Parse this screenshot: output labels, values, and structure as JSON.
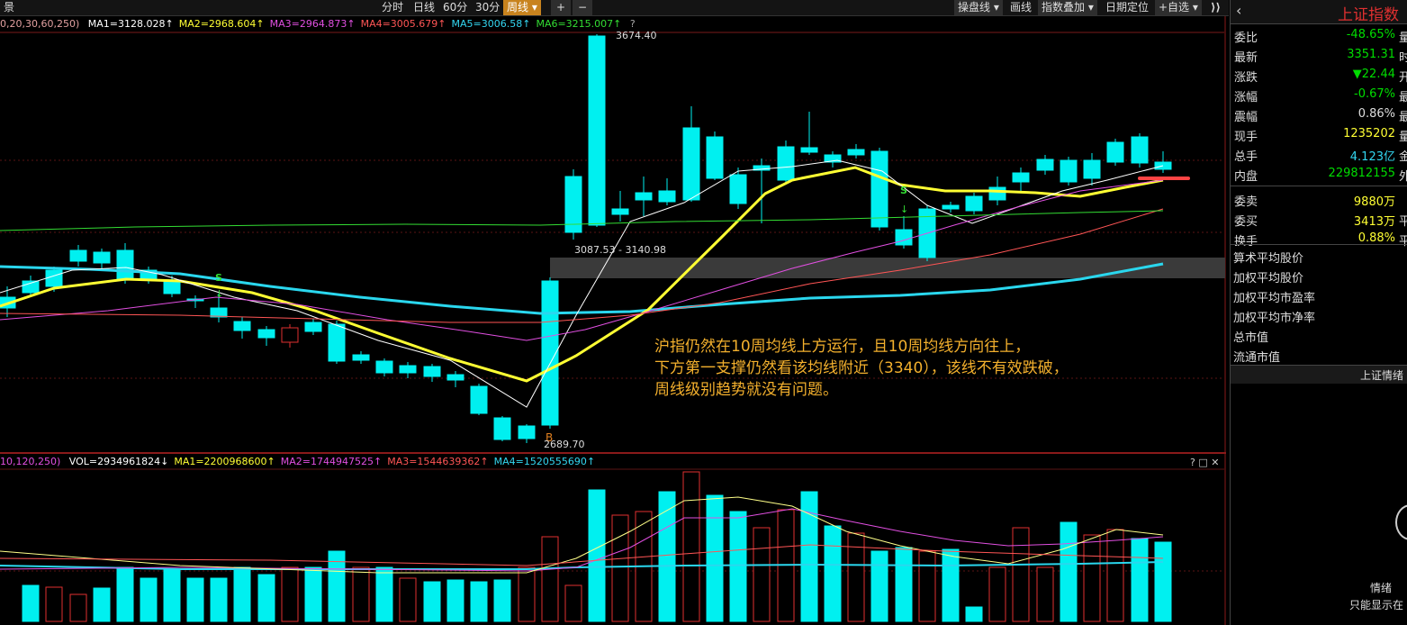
{
  "toolbar": {
    "left_label": "景",
    "buttons": [
      "分时",
      "日线",
      "60分",
      "30分",
      "周线 ▾",
      "+",
      "−"
    ],
    "right_buttons": [
      "操盘线 ▾",
      "画线",
      "指数叠加 ▾",
      "日期定位",
      "+自选 ▾"
    ]
  },
  "ma_line": {
    "prefix": "0,20,30,60,250)",
    "items": [
      {
        "text": "MA1=3128.028↑",
        "color": "#ffffff"
      },
      {
        "text": "MA2=2968.604↑",
        "color": "#ffff33"
      },
      {
        "text": "MA3=2964.873↑",
        "color": "#e14fe1"
      },
      {
        "text": "MA4=3005.679↑",
        "color": "#ff5555"
      },
      {
        "text": "MA5=3006.58↑",
        "color": "#33d6f0"
      },
      {
        "text": "MA6=3215.007↑",
        "color": "#33dd33"
      }
    ],
    "help": "?"
  },
  "price_labels": {
    "high": "3674.40",
    "range": "3087.53 - 3140.98",
    "low": "2689.70"
  },
  "annotation": {
    "line1": "沪指仍然在10周均线上方运行，且10周均线方向往上，",
    "line2": "下方第一支撑仍然看该均线附近（3340），该线不有效跌破，",
    "line3": "周线级别趋势就没有问题。"
  },
  "vol_line": {
    "prefix": "10,120,250)",
    "items": [
      {
        "text": "VOL=2934961824↓",
        "color": "#ffffff"
      },
      {
        "text": "MA1=2200968600↑",
        "color": "#ffff33"
      },
      {
        "text": "MA2=1744947525↑",
        "color": "#e14fe1"
      },
      {
        "text": "MA3=1544639362↑",
        "color": "#ff5555"
      },
      {
        "text": "MA4=1520555690↑",
        "color": "#33d6f0"
      }
    ],
    "controls": "? □ ✕"
  },
  "side_panel": {
    "title": "上证指数",
    "rows": [
      {
        "k": "委比",
        "v": "-48.65%",
        "c": "#00dd00",
        "x": "量"
      },
      {
        "k": "最新",
        "v": "3351.31",
        "c": "#00dd00",
        "x": "时"
      },
      {
        "k": "涨跌",
        "v": "▼22.44",
        "c": "#00dd00",
        "x": "开"
      },
      {
        "k": "涨幅",
        "v": "-0.67%",
        "c": "#00dd00",
        "x": "最"
      },
      {
        "k": "震幅",
        "v": "0.86%",
        "c": "#dddddd",
        "x": "最"
      },
      {
        "k": "现手",
        "v": "1235202",
        "c": "#ffff33",
        "x": "量"
      },
      {
        "k": "总手",
        "v": "4.123亿",
        "c": "#33d6f0",
        "x": "金"
      },
      {
        "k": "内盘",
        "v": "229812155",
        "c": "#00dd00",
        "x": "外"
      },
      {
        "k": "委卖",
        "v": "9880万",
        "c": "#ffff33",
        "x": ""
      },
      {
        "k": "委买",
        "v": "3413万",
        "c": "#ffff33",
        "x": "平"
      },
      {
        "k": "换手",
        "v": "0.88%",
        "c": "#ffff33",
        "x": "平"
      }
    ],
    "links": [
      "算术平均股价",
      "加权平均股价",
      "加权平均市盈率",
      "加权平均市净率",
      "总市值",
      "流通市值"
    ],
    "section": "上证情绪",
    "footer1": "情绪",
    "footer2": "只能显示在"
  }
}
